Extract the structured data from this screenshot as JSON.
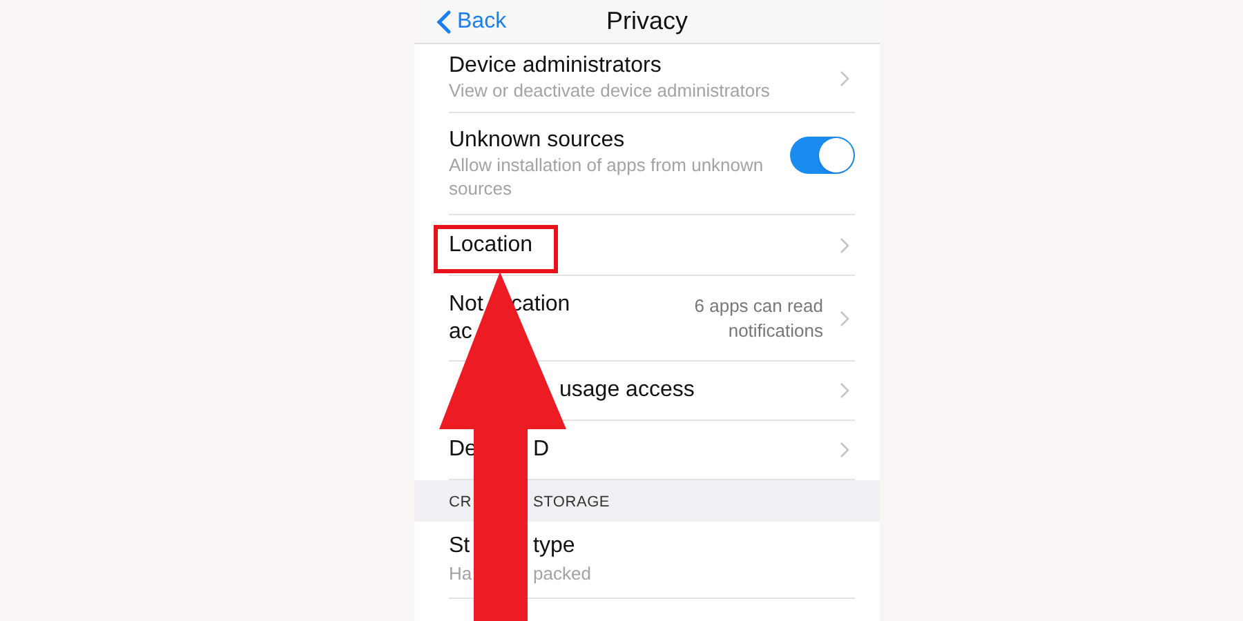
{
  "nav_bar": {
    "back": "Back",
    "title": "Privacy"
  },
  "rows": [
    {
      "kind": "nav",
      "title_lines": [
        [
          "Device administrators"
        ]
      ],
      "subtitle_lines": [
        [
          "View or deactivate device administrators"
        ]
      ]
    },
    {
      "kind": "toggle",
      "title_lines": [
        [
          "Unknown sources"
        ]
      ],
      "subtitle_lines": [
        [
          "Allow installation of apps from unknown"
        ],
        [
          "sources"
        ]
      ],
      "on": true
    },
    {
      "kind": "nav",
      "title_lines": [
        [
          "Location"
        ]
      ],
      "highlighted": true
    },
    {
      "kind": "nav",
      "title_lines": [
        [
          "Not",
          "cation"
        ],
        [
          "ac"
        ]
      ],
      "detail": [
        "6 apps can read",
        "notifications"
      ]
    },
    {
      "kind": "nav",
      "title_lines": [
        [
          "usage access"
        ]
      ]
    },
    {
      "kind": "nav",
      "title_lines": [
        [
          "De",
          "D"
        ]
      ]
    },
    {
      "kind": "section",
      "title_lines": [
        [
          "CR",
          "STORAGE"
        ]
      ]
    },
    {
      "kind": "plain",
      "title_lines": [
        [
          "St",
          "type"
        ]
      ],
      "subtitle_lines": [
        [
          "Ha",
          "packed"
        ]
      ]
    },
    {
      "kind": "plain"
    }
  ]
}
